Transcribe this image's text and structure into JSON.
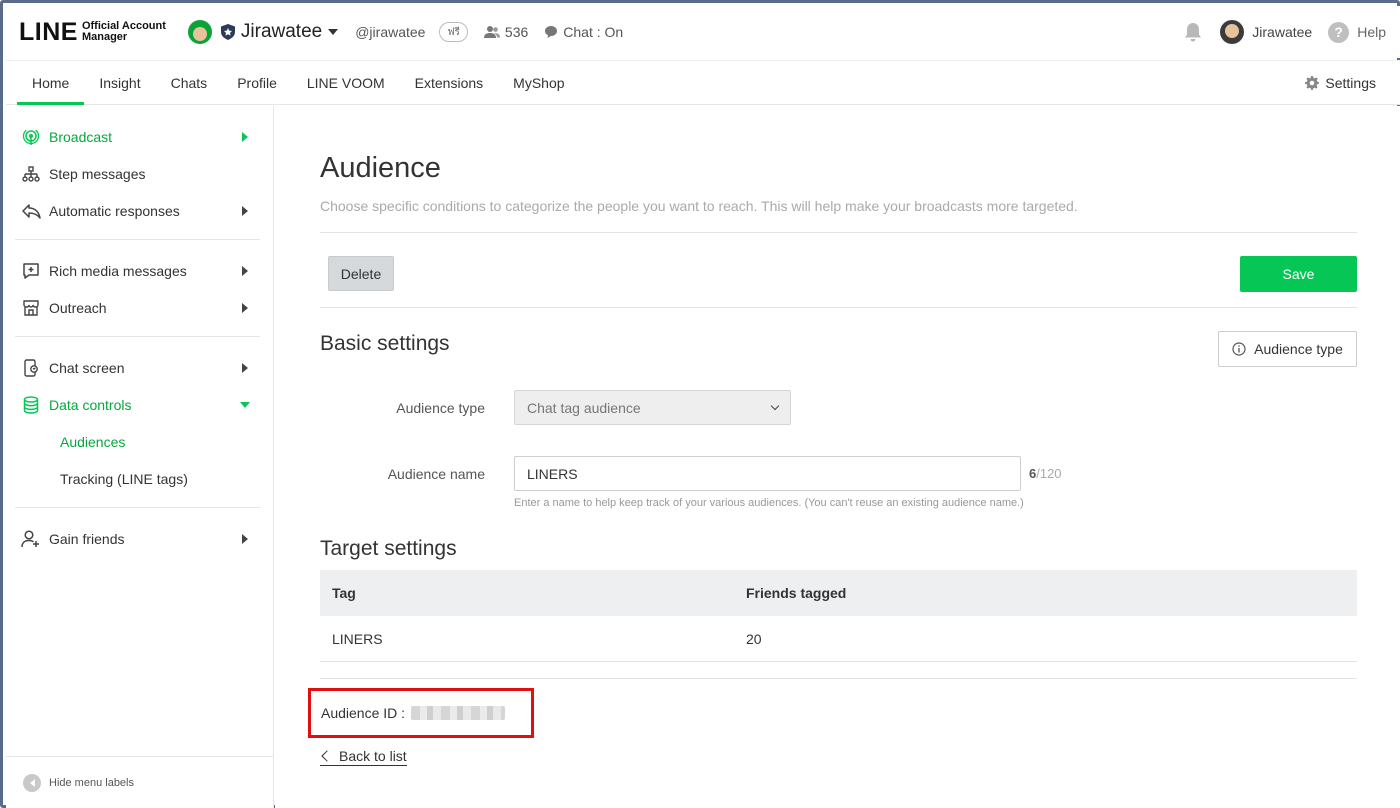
{
  "header": {
    "logo_main": "LINE",
    "logo_sub_line1": "Official Account",
    "logo_sub_line2": "Manager",
    "account_name": "Jirawatee",
    "account_handle": "@jirawatee",
    "verify_badge": "ฟรี",
    "friends_count": "536",
    "chat_status": "Chat : On",
    "user_name": "Jirawatee",
    "help_label": "Help"
  },
  "nav": {
    "tabs": [
      "Home",
      "Insight",
      "Chats",
      "Profile",
      "LINE VOOM",
      "Extensions",
      "MyShop"
    ],
    "active_tab": "Home",
    "settings_label": "Settings"
  },
  "sidebar": {
    "broadcast": "Broadcast",
    "step_messages": "Step messages",
    "automatic_responses": "Automatic responses",
    "rich_media": "Rich media messages",
    "outreach": "Outreach",
    "chat_screen": "Chat screen",
    "data_controls": "Data controls",
    "audiences": "Audiences",
    "tracking": "Tracking (LINE tags)",
    "gain_friends": "Gain friends",
    "hide_labels": "Hide menu labels"
  },
  "main": {
    "title": "Audience",
    "description": "Choose specific conditions to categorize the people you want to reach. This will help make your broadcasts more targeted.",
    "delete_label": "Delete",
    "save_label": "Save",
    "basic_settings_title": "Basic settings",
    "audience_type_button": "Audience type",
    "audience_type_label": "Audience type",
    "audience_type_value": "Chat tag audience",
    "audience_name_label": "Audience name",
    "audience_name_value": "LINERS",
    "name_count": "6",
    "name_max": "/120",
    "name_hint": "Enter a name to help keep track of your various audiences. (You can't reuse an existing audience name.)",
    "target_settings_title": "Target settings",
    "table_headers": [
      "Tag",
      "Friends tagged"
    ],
    "table_rows": [
      {
        "tag": "LINERS",
        "friends_tagged": "20"
      }
    ],
    "audience_id_label": "Audience ID :",
    "back_label": "Back to list"
  },
  "colors": {
    "accent": "#06c755",
    "highlight_box": "#e01010"
  }
}
